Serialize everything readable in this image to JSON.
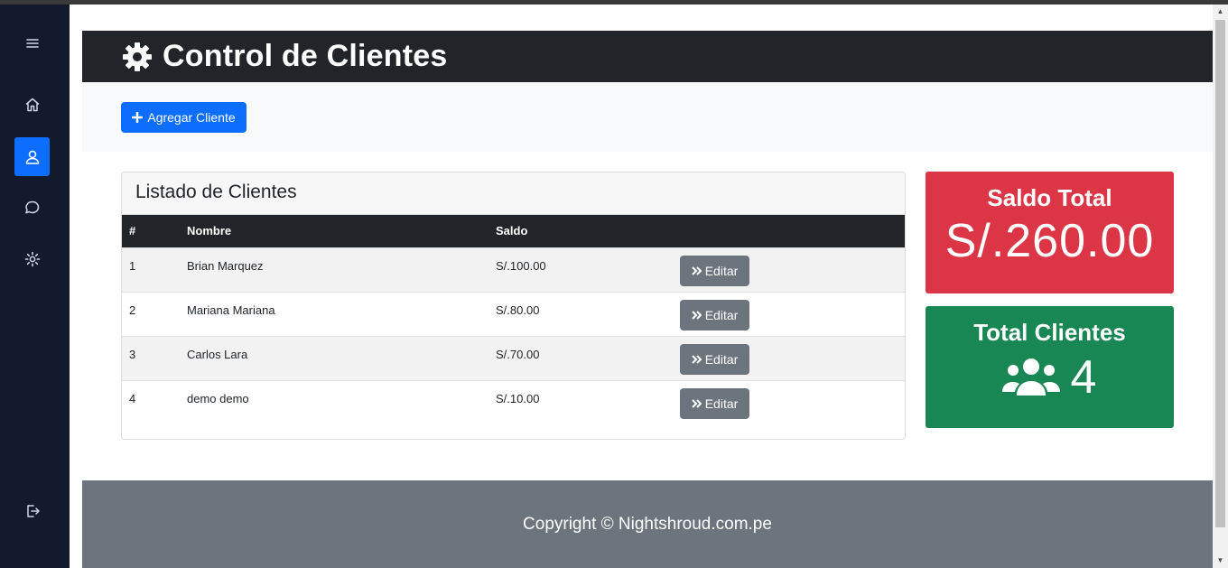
{
  "header": {
    "title": "Control de Clientes",
    "icon": "gear-icon"
  },
  "toolbar": {
    "add_label": "Agregar Cliente"
  },
  "clients_card": {
    "title": "Listado de Clientes",
    "columns": [
      "#",
      "Nombre",
      "Saldo",
      ""
    ],
    "rows": [
      {
        "num": "1",
        "name": "Brian Marquez",
        "saldo": "S/.100.00",
        "action": "Editar"
      },
      {
        "num": "2",
        "name": "Mariana Mariana",
        "saldo": "S/.80.00",
        "action": "Editar"
      },
      {
        "num": "3",
        "name": "Carlos Lara",
        "saldo": "S/.70.00",
        "action": "Editar"
      },
      {
        "num": "4",
        "name": "demo demo",
        "saldo": "S/.10.00",
        "action": "Editar"
      }
    ]
  },
  "stats": {
    "saldo_total": {
      "title": "Saldo Total",
      "value": "S/.260.00",
      "color": "#dc3545"
    },
    "total_clientes": {
      "title": "Total Clientes",
      "value": "4",
      "color": "#198754",
      "icon": "users-icon"
    }
  },
  "footer": {
    "text": "Copyright © Nightshroud.com.pe"
  },
  "sidebar": {
    "items": [
      "menu-icon",
      "home-icon",
      "user-icon",
      "chat-icon",
      "gear-icon",
      "logout-icon"
    ],
    "active": "user-icon"
  },
  "colors": {
    "accent": "#0d6efd",
    "dark": "#212529",
    "sidebar": "#131a2e",
    "button_secondary": "#6c757d"
  }
}
